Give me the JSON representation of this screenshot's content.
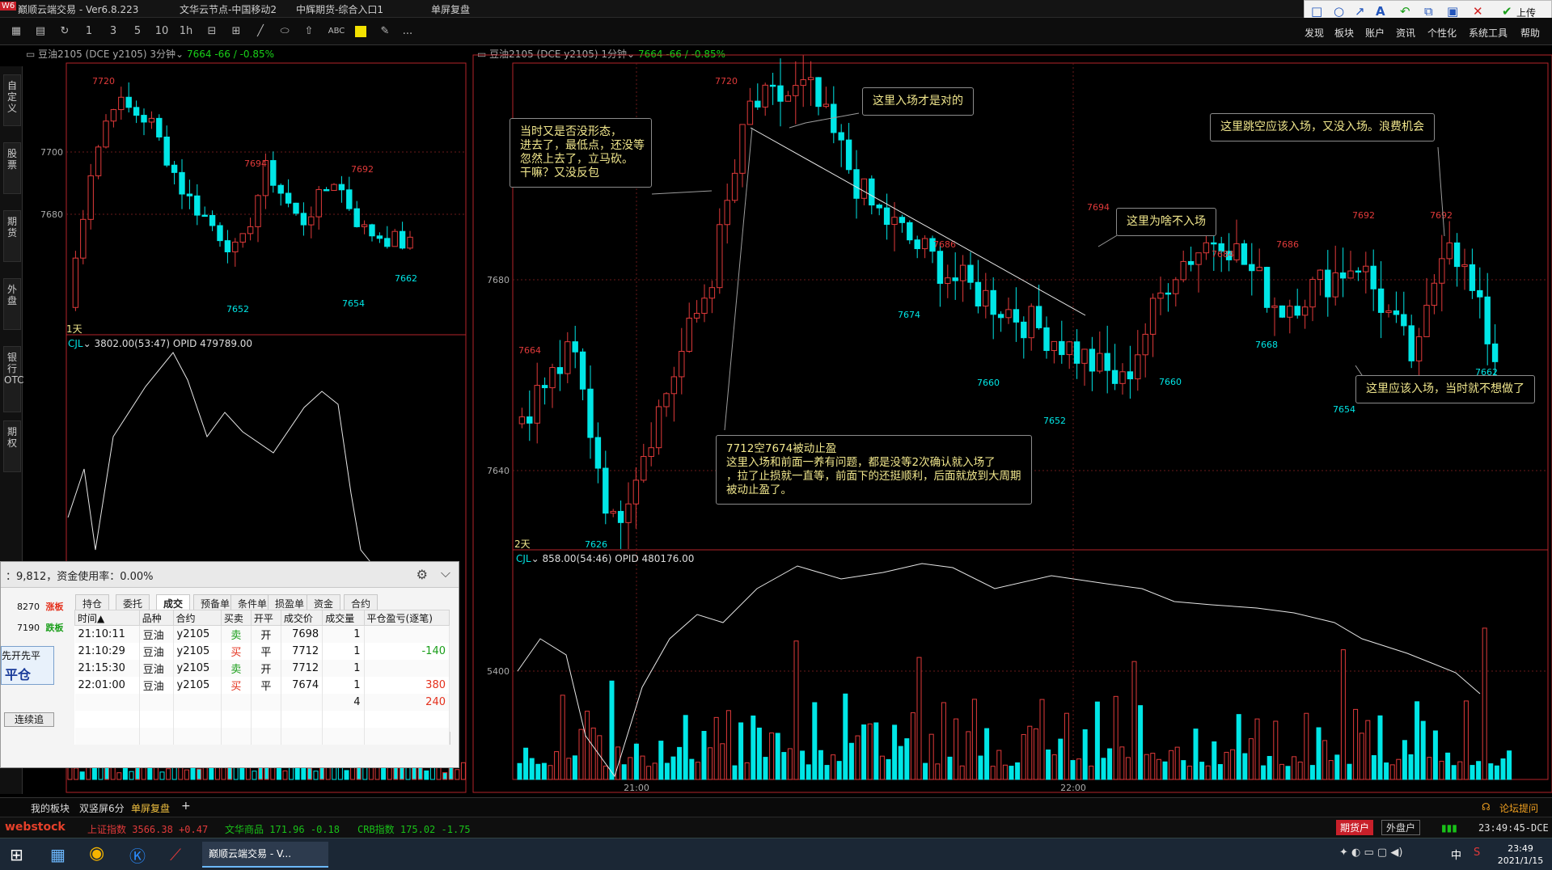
{
  "titlebar": {
    "app": "巅顺云端交易 - Ver6.8.223",
    "node": "文华云节点-中国移动2",
    "broker": "中辉期货-综合入口1",
    "mode": "单屏复盘"
  },
  "menu": {
    "upload": "上传",
    "items": [
      "发现",
      "板块",
      "账户",
      "资讯",
      "个性化",
      "系统工具",
      "帮助"
    ]
  },
  "toolbar": {
    "icons": [
      "layout-icon",
      "save-icon",
      "refresh-icon",
      "period-1-icon",
      "period-3-icon",
      "period-5-icon",
      "period-10-icon",
      "period-1h-icon",
      "split-h-icon",
      "split-grid-icon",
      "line-tool-icon",
      "ellipse-tool-icon",
      "arrow-tool-icon",
      "text-tool-icon",
      "color-fill-icon",
      "eraser-icon",
      "more-icon"
    ],
    "labels": [
      "1",
      "3",
      "5",
      "10",
      "1h",
      "ABC",
      "..."
    ]
  },
  "draw_toolbar": {
    "icons": [
      "rect-icon",
      "circle-icon",
      "arrow-icon",
      "text-icon",
      "undo-icon",
      "copy-icon",
      "save-icon",
      "close-icon",
      "check-icon"
    ]
  },
  "side_tabs": [
    "自定义",
    "股票",
    "期货",
    "外盘",
    "银行OTC",
    "期权"
  ],
  "left_panel": {
    "header": "豆油2105",
    "exchange": "(DCE y2105)",
    "period": "3分钟",
    "price": "7664",
    "change": "-66 / -0.85%",
    "sub_header": "CJL",
    "sub_values": "3802.00(53:47)  OPID 479789.00",
    "day_label": "1天",
    "y_labels": [
      "7700",
      "7680"
    ],
    "price_marks": [
      "7720",
      "7694",
      "7692",
      "7652",
      "7654",
      "7662"
    ]
  },
  "right_panel": {
    "header": "豆油2105",
    "exchange": "(DCE y2105)",
    "period": "1分钟",
    "price": "7664",
    "change": "-66 / -0.85%",
    "sub_header": "CJL",
    "sub_values": "858.00(54:46)  OPID 480176.00",
    "day_label": "2天",
    "y_labels": [
      "7680",
      "7640",
      "5400"
    ],
    "x_labels": [
      "21:00",
      "22:00"
    ],
    "price_marks_red": [
      "7720",
      "7664",
      "7694",
      "7686",
      "7684",
      "7686",
      "7692",
      "7692"
    ],
    "price_marks_cyan": [
      "7626",
      "7674",
      "7660",
      "7652",
      "7660",
      "7668",
      "7654",
      "7662"
    ]
  },
  "annotations": {
    "a1": "这里入场才是对的",
    "a2": "当时又是否没形态，\n进去了，最低点，还没等\n忽然上去了，立马砍。\n干嘛？又没反包",
    "a3": "这里为啥不入场",
    "a4": "这里跳空应该入场，又没入场。浪费机会",
    "a5": "这里应该入场，当时就不想做了",
    "a6": "7712空7674被动止盈\n这里入场和前面一养有问题，都是没等2次确认就入场了\n，拉了止损就一直等，前面下的还挺顺利，后面就放到大周期\n被动止盈了。"
  },
  "trade_window": {
    "summary": "：9,812，资金使用率：0.00%",
    "limit_up_price": "8270",
    "limit_up_label": "涨板",
    "limit_down_price": "7190",
    "limit_down_label": "跌板",
    "order_mode": "先开先平",
    "close_button": "平仓",
    "continue_button": "连续追",
    "tabs": [
      "持仓",
      "委托",
      "成交",
      "预备单",
      "条件单",
      "损盈单",
      "资金",
      "合约"
    ],
    "active_tab": "成交",
    "columns": [
      "时间▲",
      "品种",
      "合约",
      "买卖",
      "开平",
      "成交价",
      "成交量",
      "平仓盈亏(逐笔)"
    ],
    "rows": [
      {
        "time": "21:10:11",
        "name": "豆油",
        "contract": "y2105",
        "side": "卖",
        "oc": "开",
        "price": "7698",
        "qty": "1",
        "pnl": ""
      },
      {
        "time": "21:10:29",
        "name": "豆油",
        "contract": "y2105",
        "side": "买",
        "oc": "平",
        "price": "7712",
        "qty": "1",
        "pnl": "-140"
      },
      {
        "time": "21:15:30",
        "name": "豆油",
        "contract": "y2105",
        "side": "卖",
        "oc": "开",
        "price": "7712",
        "qty": "1",
        "pnl": ""
      },
      {
        "time": "22:01:00",
        "name": "豆油",
        "contract": "y2105",
        "side": "买",
        "oc": "平",
        "price": "7674",
        "qty": "1",
        "pnl": "380"
      }
    ],
    "total_qty": "4",
    "total_pnl": "240"
  },
  "bottom_tabs": [
    "我的板块",
    "双竖屏6分",
    "单屏复盘"
  ],
  "forum": "论坛提问",
  "status": {
    "brand": "webstock",
    "idx1_name": "上证指数",
    "idx1_val": "3566.38",
    "idx1_chg": "+0.47",
    "idx2_name": "文华商品",
    "idx2_val": "171.96",
    "idx2_chg": "-0.18",
    "idx3_name": "CRB指数",
    "idx3_val": "175.02",
    "idx3_chg": "-1.75",
    "acct1": "期货户",
    "acct2": "外盘户",
    "clock": "23:49:45-DCE"
  },
  "taskbar": {
    "active_app": "巅顺云端交易 - V...",
    "time": "23:49",
    "date": "2021/1/15",
    "ime": "中"
  },
  "colors": {
    "up": "#e03a3a",
    "down": "#00e6e6",
    "accent": "#f0e68c",
    "frame": "#b5232a"
  }
}
